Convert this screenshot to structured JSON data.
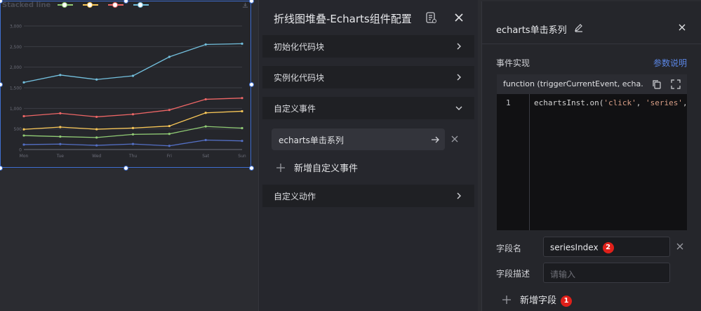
{
  "chart": {
    "title": "Stacked line",
    "legend": [
      {
        "color": "#91cc75"
      },
      {
        "color": "#fac858"
      },
      {
        "color": "#ee6666"
      },
      {
        "color": "#73c0de"
      }
    ],
    "toolbox_icon": "download-icon"
  },
  "chart_data": {
    "type": "line",
    "title": "Stacked line",
    "categories": [
      "Mon",
      "Tue",
      "Wed",
      "Thu",
      "Fri",
      "Sat",
      "Sun"
    ],
    "ylim": [
      0,
      3000
    ],
    "yticks": [
      "0",
      "500",
      "1,000",
      "1,500",
      "2,000",
      "2,500",
      "3,000"
    ],
    "grid": true,
    "series": [
      {
        "color": "#5470c6",
        "values": [
          120,
          132,
          101,
          134,
          90,
          230,
          210
        ]
      },
      {
        "color": "#91cc75",
        "values": [
          340,
          314,
          292,
          368,
          380,
          560,
          520
        ]
      },
      {
        "color": "#fac858",
        "values": [
          490,
          546,
          493,
          522,
          570,
          890,
          930
        ]
      },
      {
        "color": "#ee6666",
        "values": [
          810,
          880,
          794,
          856,
          960,
          1220,
          1250
        ]
      },
      {
        "color": "#73c0de",
        "values": [
          1630,
          1810,
          1700,
          1790,
          2250,
          2550,
          2570
        ]
      }
    ]
  },
  "config": {
    "title": "折线图堆叠-Echarts组件配置",
    "sections": {
      "init_code": "初始化代码块",
      "instance_code": "实例化代码块",
      "custom_events": "自定义事件",
      "custom_actions": "自定义动作"
    },
    "event_item": "echarts单击系列",
    "add_event": "新增自定义事件"
  },
  "series_panel": {
    "title": "echarts单击系列",
    "impl_label": "事件实现",
    "param_link": "参数说明",
    "editor_signature": "function (triggerCurrentEvent, echa...",
    "line_number": "1",
    "code_prefix": "echartsInst.on(",
    "code_str1": "'click'",
    "code_sep": ", ",
    "code_str2": "'series'",
    "code_suffix": ",",
    "field_name_label": "字段名",
    "field_name_value": "seriesIndex",
    "field_desc_label": "字段描述",
    "field_desc_placeholder": "请输入",
    "add_field": "新增字段",
    "badge_2": "2",
    "badge_1": "1",
    "accent": "#5b86e5",
    "badge_color": "#e0201a"
  }
}
